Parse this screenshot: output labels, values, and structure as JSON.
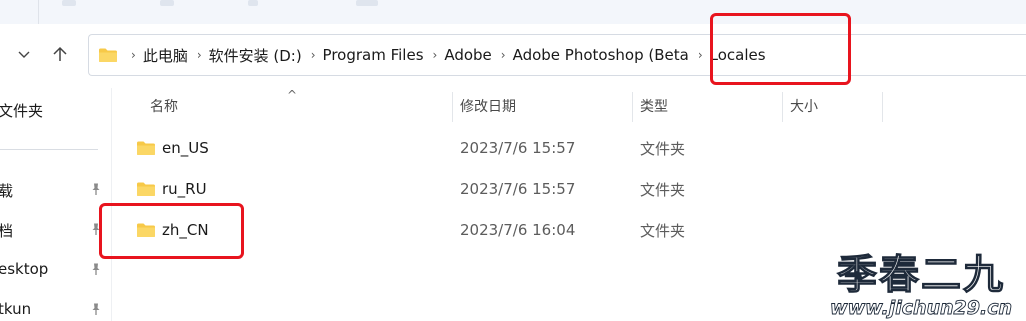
{
  "nav": {
    "dropdown_icon": "chevron-down-icon",
    "up_icon": "arrow-up-icon"
  },
  "address_bar": {
    "breadcrumbs": [
      "此电脑",
      "软件安装 (D:)",
      "Program Files",
      "Adobe",
      "Adobe Photoshop (Beta",
      "Locales"
    ]
  },
  "sidebar": {
    "items": [
      {
        "label": "文件夹",
        "pinned": false
      },
      {
        "label": "载",
        "pinned": true
      },
      {
        "label": "档",
        "pinned": true
      },
      {
        "label": "esktop",
        "pinned": true
      },
      {
        "label": "tkun",
        "pinned": true
      }
    ]
  },
  "columns": {
    "name": "名称",
    "modified": "修改日期",
    "type": "类型",
    "size": "大小"
  },
  "files": [
    {
      "name": "en_US",
      "modified": "2023/7/6 15:57",
      "type": "文件夹"
    },
    {
      "name": "ru_RU",
      "modified": "2023/7/6 15:57",
      "type": "文件夹"
    },
    {
      "name": "zh_CN",
      "modified": "2023/7/6 16:04",
      "type": "文件夹"
    }
  ],
  "watermark": {
    "title": "季春二九",
    "url": "www.jichun29.cn"
  },
  "colors": {
    "highlight": "#e8141e",
    "folder": "#f7c948"
  }
}
